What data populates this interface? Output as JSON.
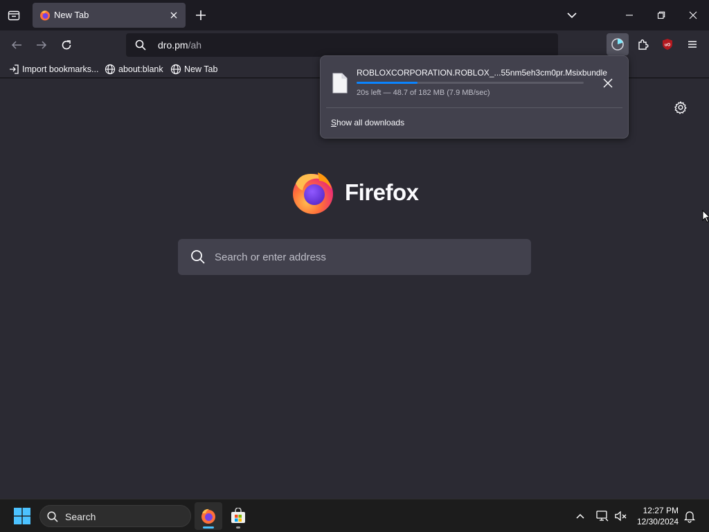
{
  "tab": {
    "title": "New Tab"
  },
  "urlbar": {
    "host": "dro.pm",
    "path": "/ah"
  },
  "bookmarks": [
    {
      "label": "Import bookmarks..."
    },
    {
      "label": "about:blank"
    },
    {
      "label": "New Tab"
    }
  ],
  "newtab": {
    "brand": "Firefox",
    "search_placeholder": "Search or enter address"
  },
  "download": {
    "filename": "ROBLOXCORPORATION.ROBLOX_...55nm5eh3cm0pr.Msixbundle",
    "status": "20s left — 48.7 of 182 MB (7.9 MB/sec)",
    "progress_fraction": 0.267,
    "show_all_accesskey": "S",
    "show_all_rest": "how all downloads"
  },
  "taskbar": {
    "search_label": "Search",
    "time": "12:27 PM",
    "date": "12/30/2024"
  },
  "colors": {
    "accent": "#0a84ff",
    "tabstrip_bg": "#1c1b22",
    "toolbar_bg": "#2b2a33",
    "panel_bg": "#42414d",
    "ublock_red": "#b3191f"
  },
  "icons": {
    "tab_list": "tab-list-icon",
    "favicon": "firefox-icon",
    "download": "download-progress-icon",
    "extensions": "puzzle-icon",
    "ublock": "ublock-origin-icon",
    "menu": "hamburger-menu-icon",
    "settings": "gear-icon",
    "file": "file-icon"
  }
}
